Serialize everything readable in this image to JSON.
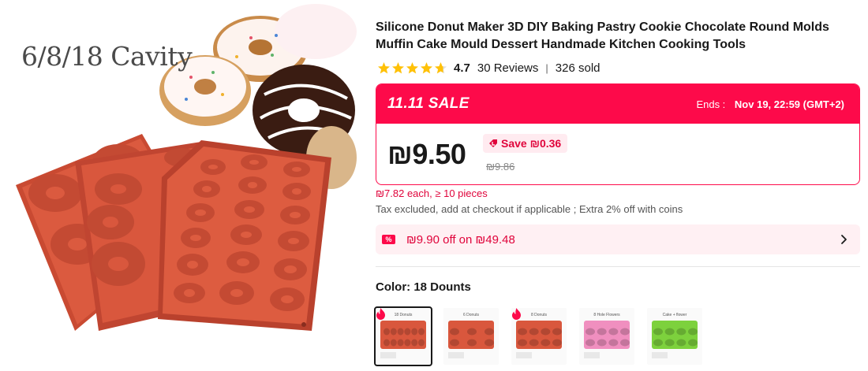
{
  "hero": {
    "cavity_text": "6/8/18 Cavity"
  },
  "product": {
    "title": "Silicone Donut Maker 3D DIY Baking Pastry Cookie Chocolate Round Molds Muffin Cake Mould Dessert Handmade Kitchen Cooking Tools",
    "rating": "4.7",
    "reviews": "30 Reviews",
    "separator": "|",
    "sold": "326 sold",
    "stars": 4.7
  },
  "sale": {
    "tag": "11.11 SALE",
    "ends_label": "Ends :",
    "ends_value": "Nov 19, 22:59 (GMT+2)",
    "price": "₪9.50",
    "save": "Save ₪0.36",
    "original_price": "₪9.86"
  },
  "bulk_text": "₪7.82 each, ≥ 10 pieces",
  "tax_text": "Tax excluded, add at checkout if applicable ; Extra 2% off with coins",
  "coupon": {
    "icon": "%",
    "text": "₪9.90 off on ₪49.48"
  },
  "color": {
    "label": "Color: 18 Dounts",
    "options": [
      {
        "caption": "18 Donuts",
        "selected": true,
        "hot": true,
        "color": "#d9573d"
      },
      {
        "caption": "6 Donuts",
        "selected": false,
        "hot": false,
        "color": "#d9573d"
      },
      {
        "caption": "8 Donuts",
        "selected": false,
        "hot": true,
        "color": "#d9573d"
      },
      {
        "caption": "8 Hole Flowers",
        "selected": false,
        "hot": false,
        "color": "#f08fbf"
      },
      {
        "caption": "Cake + flower",
        "selected": false,
        "hot": false,
        "color": "#7dd13d"
      }
    ]
  },
  "colors": {
    "accent": "#fd0a4a",
    "accent_text": "#e0043b",
    "star": "#ffc107",
    "mold": "#d9573d"
  }
}
